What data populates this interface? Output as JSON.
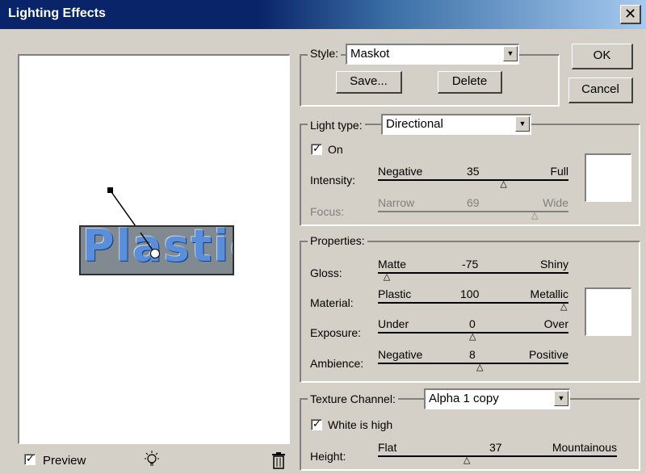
{
  "window": {
    "title": "Lighting Effects",
    "close_glyph": "✕"
  },
  "preview": {
    "label": "Preview",
    "checked": true,
    "sample_text": "Plastic"
  },
  "style": {
    "label": "Style:",
    "value": "Maskot",
    "save_label": "Save...",
    "delete_label": "Delete"
  },
  "buttons": {
    "ok": "OK",
    "cancel": "Cancel"
  },
  "light_type": {
    "label": "Light type:",
    "value": "Directional",
    "on_label": "On",
    "on_checked": true,
    "intensity": {
      "label": "Intensity:",
      "low": "Negative",
      "value": "35",
      "high": "Full",
      "level": 0.67
    },
    "focus": {
      "label": "Focus:",
      "low": "Narrow",
      "value": "69",
      "high": "Wide",
      "level": 0.84,
      "disabled": true
    }
  },
  "properties": {
    "label": "Properties:",
    "gloss": {
      "label": "Gloss:",
      "low": "Matte",
      "value": "-75",
      "high": "Shiny",
      "level": 0.03
    },
    "material": {
      "label": "Material:",
      "low": "Plastic",
      "value": "100",
      "high": "Metallic",
      "level": 1.0
    },
    "exposure": {
      "label": "Exposure:",
      "low": "Under",
      "value": "0",
      "high": "Over",
      "level": 0.5
    },
    "ambience": {
      "label": "Ambience:",
      "low": "Negative",
      "value": "8",
      "high": "Positive",
      "level": 0.54
    }
  },
  "texture": {
    "label": "Texture Channel:",
    "value": "Alpha 1 copy",
    "white_high_label": "White is high",
    "white_high_checked": true,
    "height": {
      "label": "Height:",
      "low": "Flat",
      "value": "37",
      "high": "Mountainous",
      "level": 0.37
    }
  },
  "colors": {
    "swatch": "#ffffff",
    "title_bar": "#0a246a",
    "face": "#d4d0c8"
  }
}
